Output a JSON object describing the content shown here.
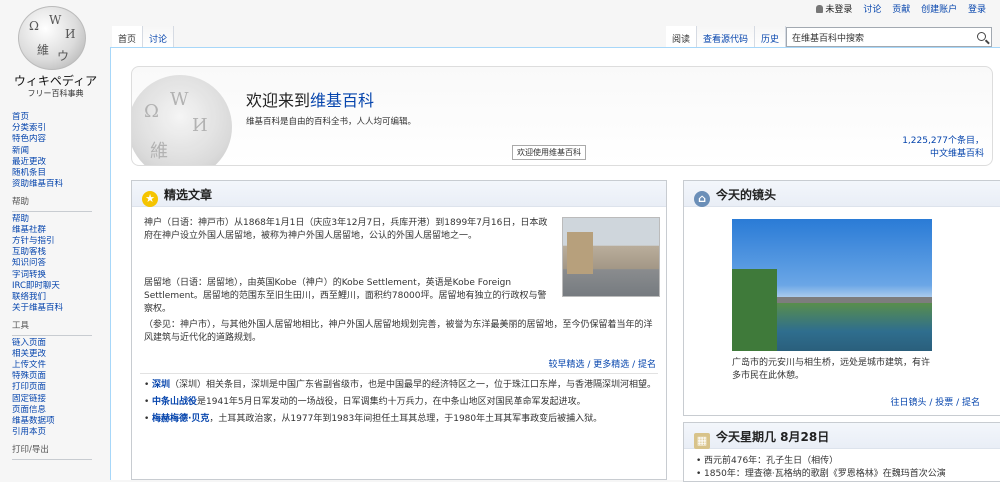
{
  "logo": {
    "wordmark": "ウィキペディア",
    "tagline": "フリー百科事典"
  },
  "personal": {
    "user": "未登录",
    "talk": "讨论",
    "contributions": "贡献",
    "create_account": "创建账户",
    "login": "登录"
  },
  "tabs_left": [
    "首页",
    "讨论"
  ],
  "tabs_right": [
    "阅读",
    "查看源代码",
    "历史"
  ],
  "search": {
    "value": "在维基百科中搜索"
  },
  "sidebar": {
    "nav": [
      "首页",
      "分类索引",
      "特色内容",
      "新闻",
      "最近更改",
      "随机条目",
      "资助维基百科"
    ],
    "help_title": "帮助",
    "help": [
      "帮助",
      "维基社群",
      "方针与指引",
      "互助客栈",
      "知识问答",
      "字词转换",
      "IRC即时聊天",
      "联络我们",
      "关于维基百科"
    ],
    "tools_title": "工具",
    "tools": [
      "链入页面",
      "相关更改",
      "上传文件",
      "特殊页面",
      "打印页面",
      "固定链接",
      "页面信息",
      "维基数据项",
      "引用本页"
    ],
    "print_title": "打印/导出"
  },
  "banner": {
    "welcome_prefix": "欢迎来到",
    "welcome_link": "维基百科",
    "subtitle": "维基百科是自由的百科全书，人人均可编辑。",
    "button": "欢迎使用维基百科",
    "stats_line1": "1,225,277个条目，",
    "stats_line2": "中文维基百科"
  },
  "featured": {
    "title": "精选文章",
    "p1": "神户（日语：神戸市）从1868年1月1日（庆应3年12月7日，兵库开港）到1899年7月16日，日本政府在神户设立外国人居留地，被称为神户外国人居留地，公认的外国人居留地之一。",
    "p2": "居留地（日语：居留地），由英国Kobe（神户）的Kobe Settlement，英语是Kobe Foreign Settlement。居留地的范围东至旧生田川，西至鯉川，面积约78000坪。居留地有独立的行政权与警察权。",
    "p3": "（参见：神户市），与其他外国人居留地相比，神户外国人居留地规划完善，被誉为东洋最美丽的居留地，至今仍保留着当年的洋风建筑与近代化的道路规划。",
    "more": "较早精选 / 更多精选 / 提名",
    "items": [
      {
        "bold": "深圳",
        "text": "（深圳）相关条目，深圳是中国广东省副省级市，也是中国最早的经济特区之一，位于珠江口东岸，与香港隔深圳河相望。"
      },
      {
        "bold": "中条山战役",
        "text": "是1941年5月日军发动的一场战役，日军调集约十万兵力，在中条山地区对国民革命军发起进攻。"
      },
      {
        "bold": "梅赫梅德·贝克",
        "text": "，土耳其政治家，从1977年到1983年间担任土耳其总理，于1980年土耳其军事政变后被捕入狱。"
      }
    ]
  },
  "picture": {
    "title": "今天的镜头",
    "caption": "广岛市的元安川与相生桥，远处是城市建筑，有许多市民在此休憩。",
    "foot": "往日镜头 / 投票 / 提名"
  },
  "onthisday": {
    "title": "今天星期几 8月28日",
    "items": [
      "西元前476年：孔子生日（相传）",
      "1850年：理查德·瓦格纳的歌剧《罗恩格林》在魏玛首次公演"
    ]
  }
}
